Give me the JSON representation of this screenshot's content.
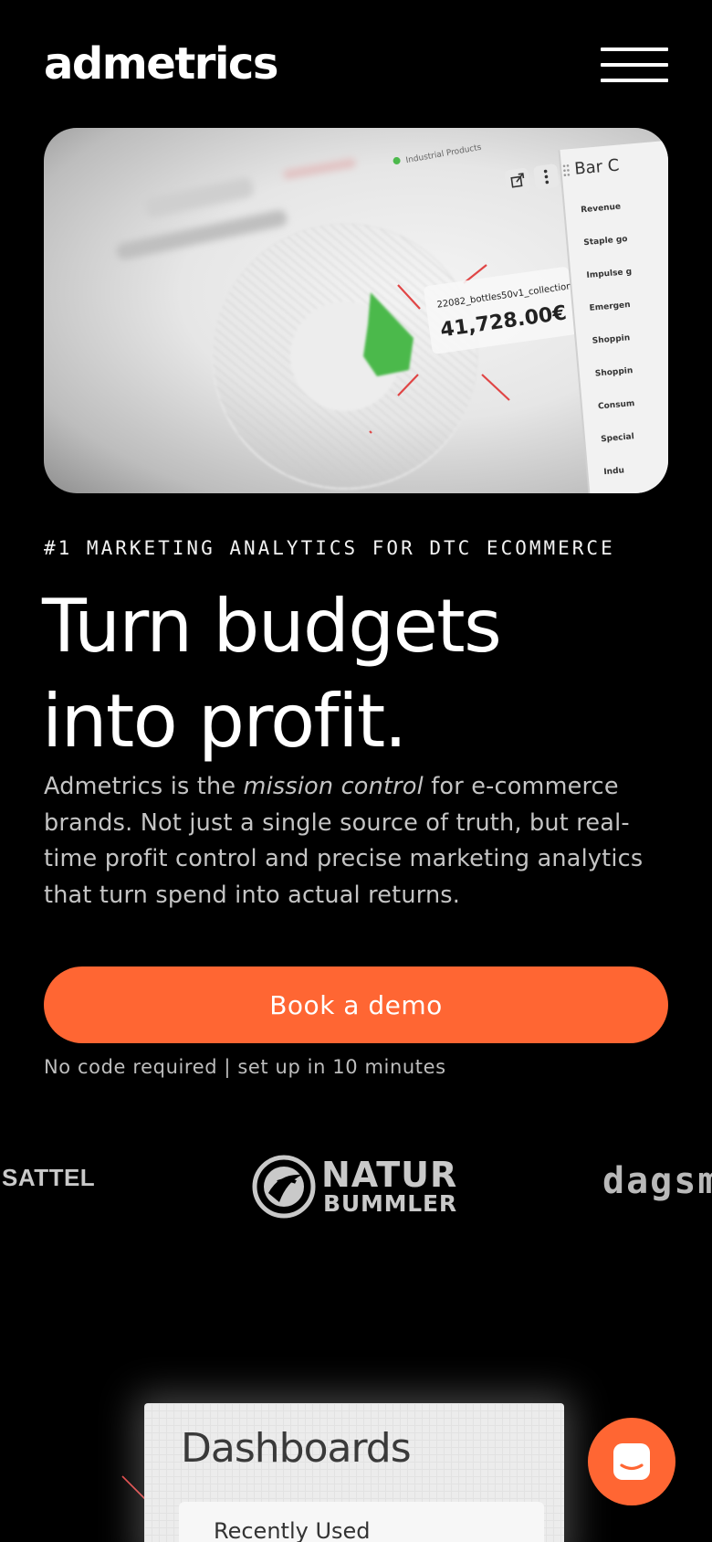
{
  "header": {
    "logo_text": "admetrics",
    "menu_icon": "hamburger-menu-icon"
  },
  "hero_image": {
    "legend_item": "Industrial Products",
    "side_panel_title": "Bar C",
    "side_panel_items": [
      "Revenue",
      "Staple go",
      "Impulse g",
      "Emergen",
      "Shoppin",
      "Shoppin",
      "Consum",
      "Special",
      "Indu"
    ],
    "tooltip_label": "22082_bottles50v1_collection",
    "tooltip_value": "41,728.00€",
    "icons": [
      "external-link-icon",
      "more-vertical-icon",
      "drag-handle-icon"
    ]
  },
  "hero": {
    "eyebrow": "#1 MARKETING ANALYTICS FOR DTC ECOMMERCE",
    "headline_line1": "Turn budgets",
    "headline_line2": "into profit.",
    "desc_before": "Admetrics is the ",
    "desc_em": "mission control",
    "desc_after": " for e-commerce brands. Not just a single source of truth, but real-time profit control and precise marketing analytics that turn spend into actual returns.",
    "cta_label": "Book a demo",
    "cta_note": "No code required | set up in 10 minutes",
    "accent_color": "#ff6633"
  },
  "logos": {
    "brand_1": "SATTEL",
    "brand_2_line1": "NATUR",
    "brand_2_line2": "BUMMLER",
    "brand_3": "dagsm"
  },
  "dashboard_preview": {
    "title": "Dashboards",
    "subtitle": "Recently Used"
  },
  "chat": {
    "icon": "chat-bubble-icon"
  }
}
